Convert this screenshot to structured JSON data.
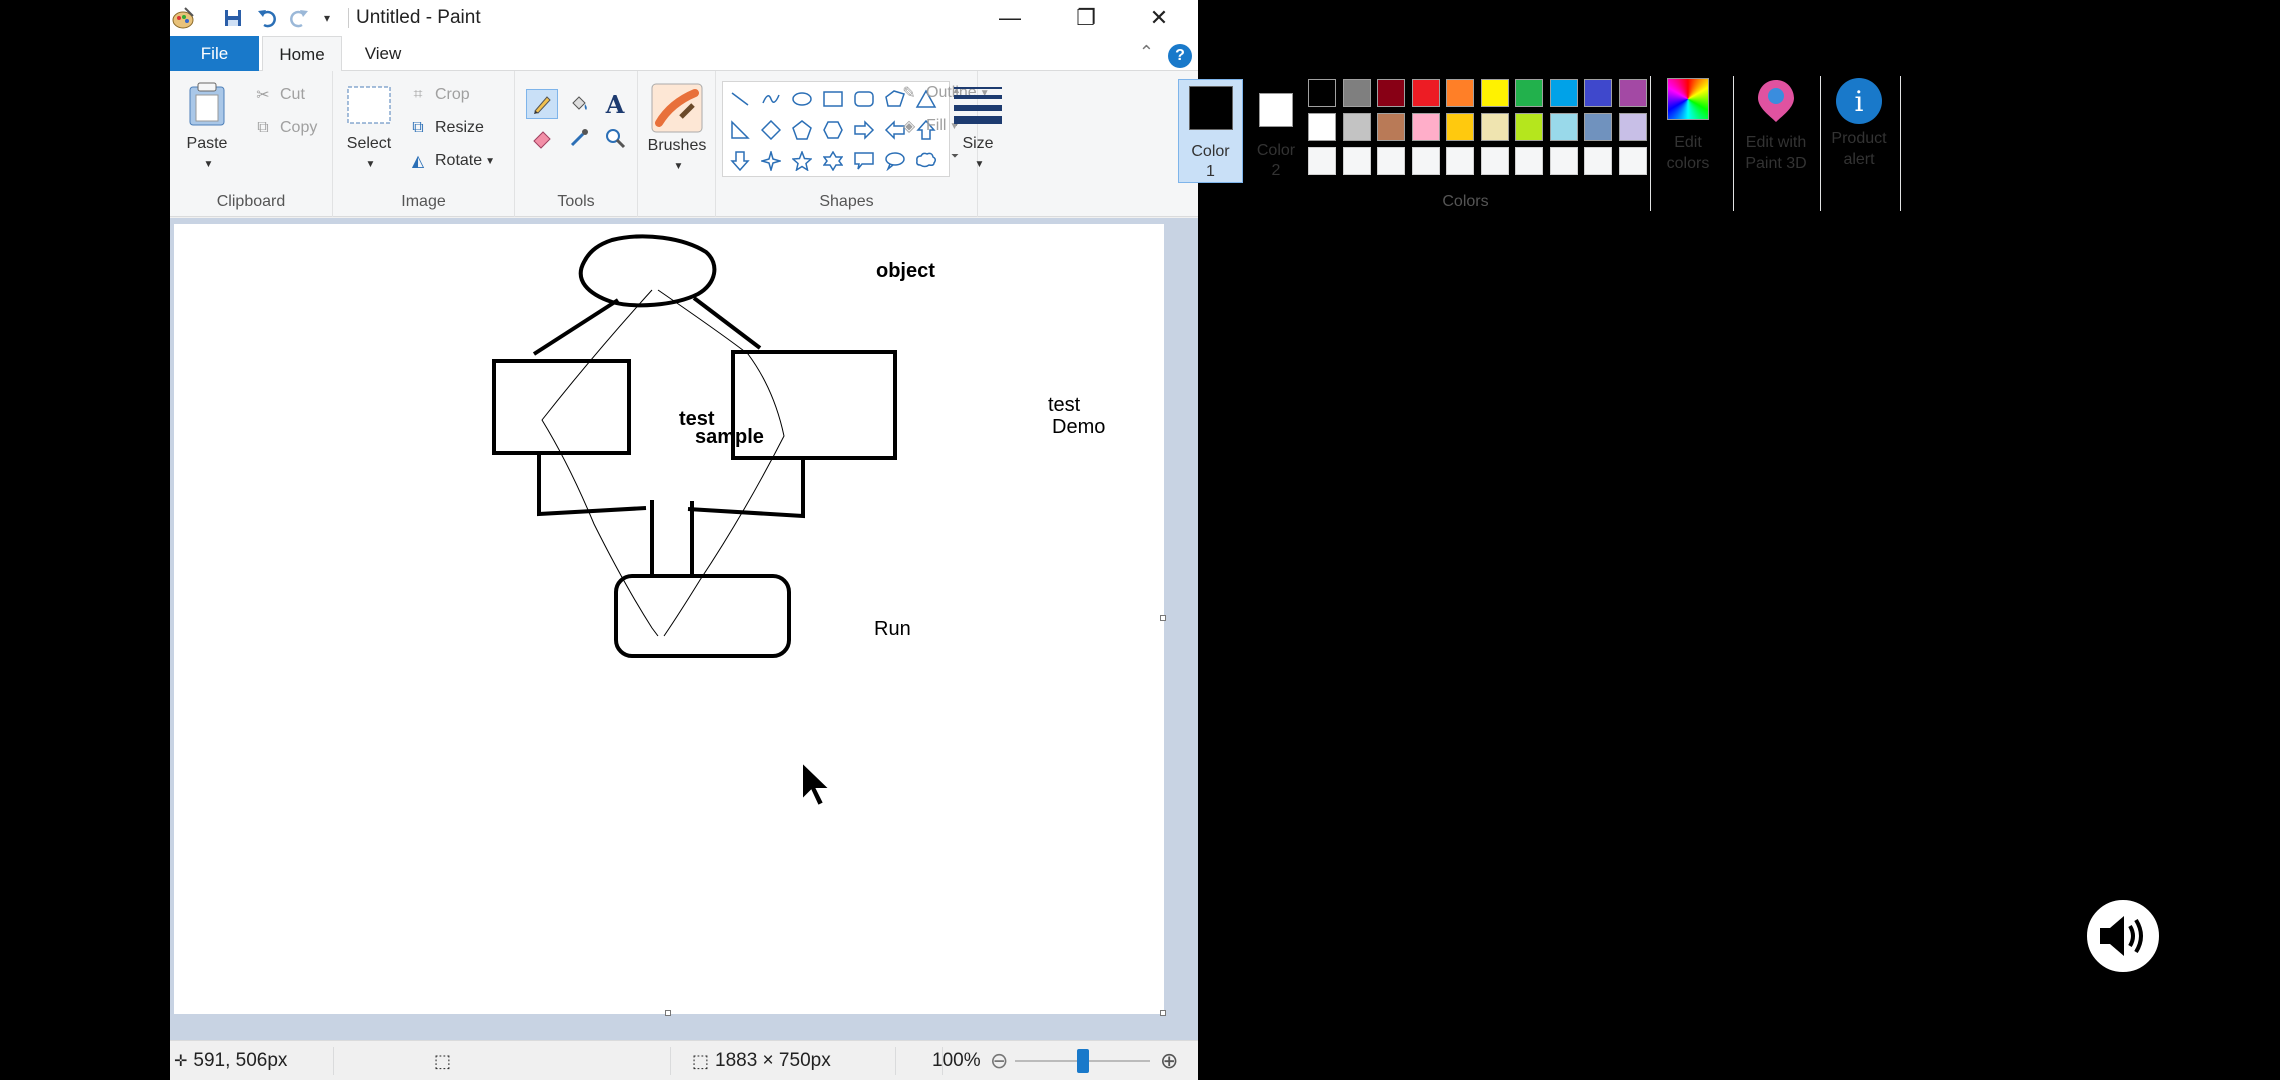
{
  "window": {
    "title": "Untitled - Paint",
    "quick_access": [
      "paint-app-icon",
      "save-icon",
      "undo-icon",
      "redo-icon",
      "customize-icon"
    ],
    "controls": {
      "minimize": "—",
      "restore": "❐",
      "close": "✕"
    }
  },
  "tabs": {
    "file": "File",
    "home": "Home",
    "view": "View"
  },
  "help": "?",
  "ribbon": {
    "clipboard": {
      "label": "Clipboard",
      "paste": "Paste",
      "cut": "Cut",
      "copy": "Copy"
    },
    "image": {
      "label": "Image",
      "select": "Select",
      "crop": "Crop",
      "resize": "Resize",
      "rotate": "Rotate"
    },
    "tools": {
      "label": "Tools",
      "active_tool": "pencil"
    },
    "brushes": {
      "label": "Brushes"
    },
    "shapes": {
      "label": "Shapes",
      "outline": "Outline",
      "fill": "Fill"
    },
    "size": {
      "label": "Size"
    },
    "colors": {
      "label": "Colors",
      "color1_label": "Color",
      "color1_num": "1",
      "color2_label": "Color",
      "color2_num": "2",
      "color1": "#000000",
      "color2": "#ffffff",
      "palette_row1": [
        "#000000",
        "#7f7f7f",
        "#880015",
        "#ed1c24",
        "#ff7f27",
        "#fff200",
        "#22b14c",
        "#00a2e8",
        "#3f48cc",
        "#a349a4"
      ],
      "palette_row2": [
        "#ffffff",
        "#c3c3c3",
        "#b97a57",
        "#ffaec9",
        "#ffc90e",
        "#efe4b0",
        "#b5e61d",
        "#99d9ea",
        "#7092be",
        "#c8bfe7"
      ],
      "edit_colors_1": "Edit",
      "edit_colors_2": "colors"
    },
    "paint3d": {
      "line1": "Edit with",
      "line2": "Paint 3D"
    },
    "product_alert": {
      "line1": "Product",
      "line2": "alert"
    }
  },
  "canvas": {
    "texts": {
      "object": "object",
      "test1": "test",
      "sample": "sample",
      "test2": "test",
      "demo": "Demo",
      "run": "Run"
    }
  },
  "status": {
    "cursor_pos": "591, 506px",
    "canvas_size": "1883 × 750px",
    "zoom": "100%",
    "zoom_out": "⊖",
    "zoom_in": "⊕"
  }
}
